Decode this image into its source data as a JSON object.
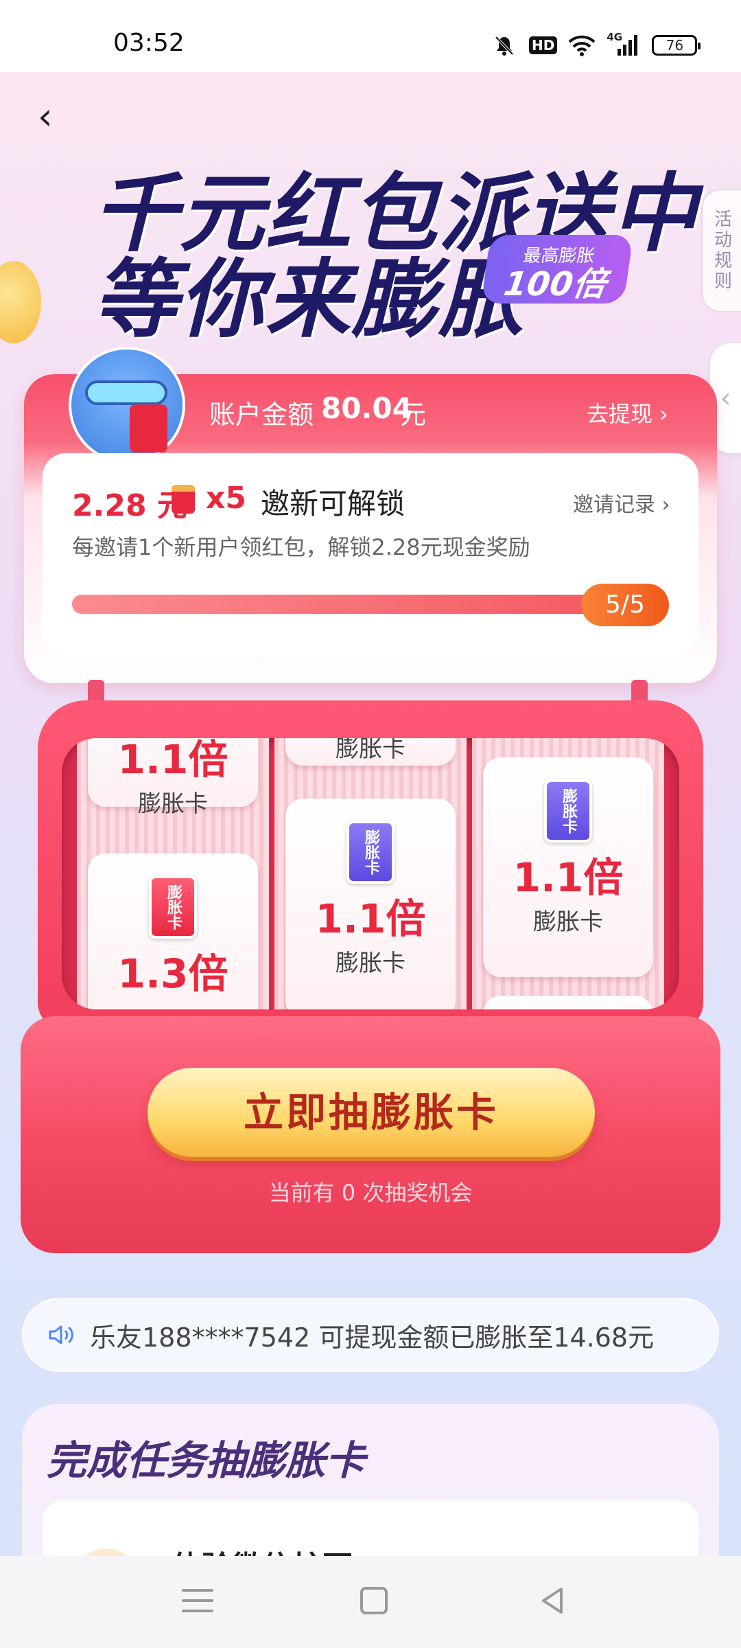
{
  "status_bar": {
    "time": "03:52",
    "network": "4G",
    "hd_label": "HD",
    "battery": "76"
  },
  "header": {
    "title_line1": "千元红包派送中",
    "title_line2": "等你来膨胀",
    "max_badge_top": "最高膨胀",
    "max_badge_value": "100倍",
    "rules_label": "活动规则"
  },
  "account": {
    "label": "账户金额",
    "amount": "80.04",
    "unit": "元",
    "withdraw_label": "去提现 ›"
  },
  "invite": {
    "reward_amount": "2.28 元",
    "reward_multiplier": "x5",
    "unlock_label": "邀新可解锁",
    "record_label": "邀请记录 ›",
    "description": "每邀请1个新用户领红包，解锁2.28元现金奖励",
    "progress_label": "5/5",
    "progress_fraction": 1.0
  },
  "slot_cards": {
    "card_type": "膨胀卡",
    "icon_text": "膨胀卡",
    "col1_top_mult": "1.1倍",
    "col1_bottom_mult": "1.3倍",
    "col2_mult": "1.1倍",
    "col3_mult": "1.1倍"
  },
  "draw": {
    "button_label": "立即抽膨胀卡",
    "chances_text": "当前有 0 次抽奖机会"
  },
  "marquee": {
    "text": "乐友188****7542 可提现金额已膨胀至14.68元"
  },
  "tasks": {
    "title": "完成任务抽膨胀卡",
    "first_task": "体验微信护耳"
  },
  "colors": {
    "accent_red": "#e8283f",
    "title_navy": "#1e1a66",
    "cta_yellow": "#ffd86b",
    "progress_orange": "#f05a1c"
  }
}
